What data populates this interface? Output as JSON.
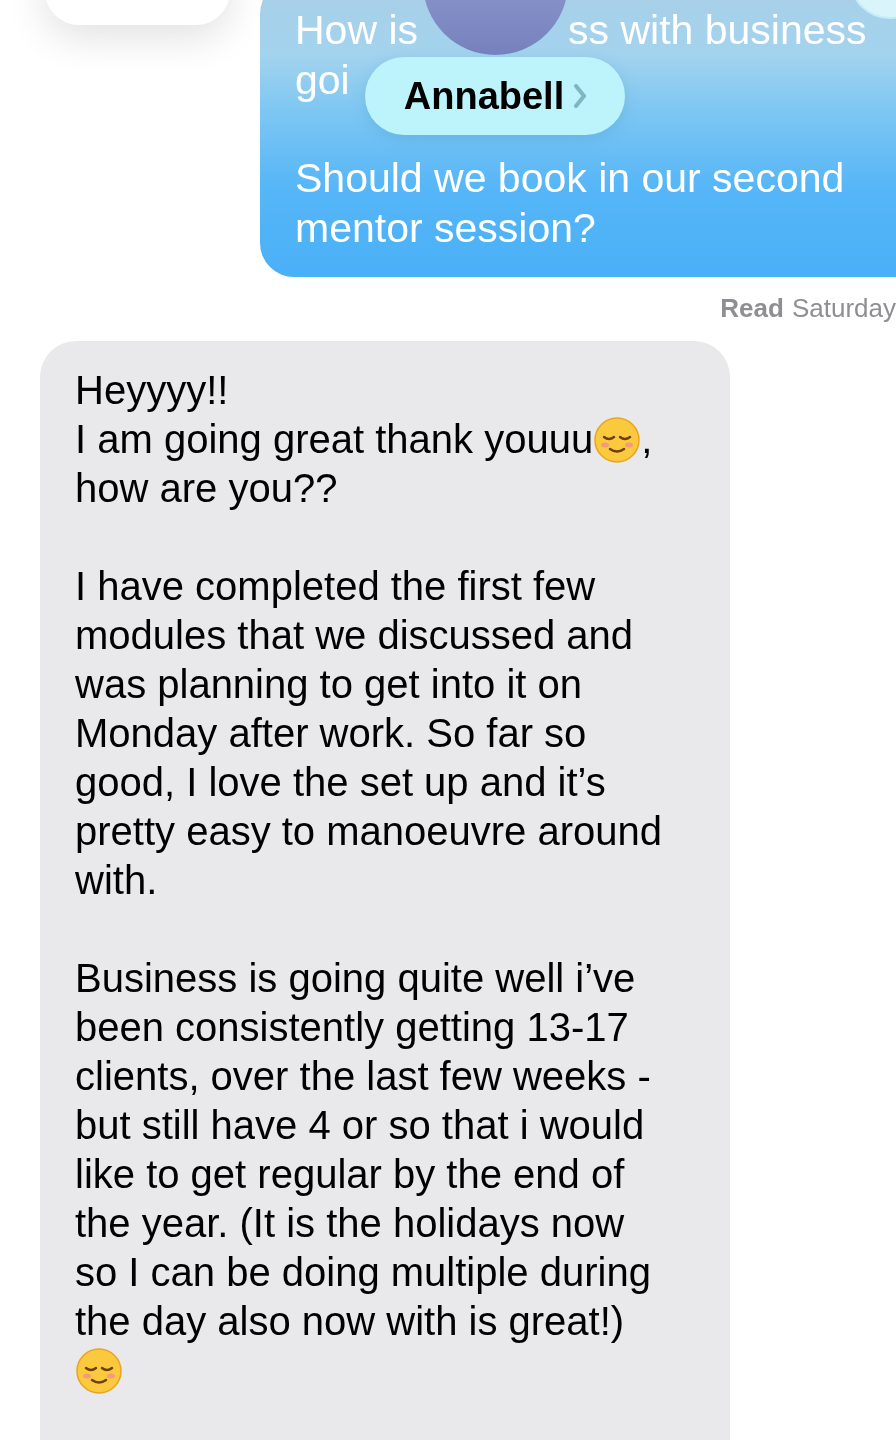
{
  "sent_message_hidden": {
    "lines": [
      {
        "fragments": [
          "How is",
          "ss with business"
        ]
      },
      {
        "fragments": [
          "goi"
        ]
      }
    ]
  },
  "contact_pill": {
    "name": "Annabell"
  },
  "sent_message": {
    "text": "Should we book in our second\nmentor session?"
  },
  "read_receipt": {
    "label": "Read",
    "time": "Saturday"
  },
  "received_message": {
    "paragraphs": [
      {
        "lines": [
          [
            {
              "kind": "text",
              "text": "Heyyyy!!"
            }
          ],
          [
            {
              "kind": "text",
              "text": "I am going great thank youuu"
            },
            {
              "kind": "emoji"
            },
            {
              "kind": "text",
              "text": ","
            }
          ],
          [
            {
              "kind": "text",
              "text": "how are you??"
            }
          ]
        ]
      },
      {
        "lines": [
          [
            {
              "kind": "text",
              "text": "I have completed the first few"
            }
          ],
          [
            {
              "kind": "text",
              "text": "modules that we discussed and"
            }
          ],
          [
            {
              "kind": "text",
              "text": "was planning to get into it on"
            }
          ],
          [
            {
              "kind": "text",
              "text": "Monday after work. So far so"
            }
          ],
          [
            {
              "kind": "text",
              "text": "good, I love the set up and it’s"
            }
          ],
          [
            {
              "kind": "text",
              "text": "pretty easy to manoeuvre around"
            }
          ],
          [
            {
              "kind": "text",
              "text": "with."
            }
          ]
        ]
      },
      {
        "lines": [
          [
            {
              "kind": "text",
              "text": "Business is going quite well i’ve"
            }
          ],
          [
            {
              "kind": "text",
              "text": "been consistently getting 13-17"
            }
          ],
          [
            {
              "kind": "text",
              "text": "clients, over the last few weeks -"
            }
          ],
          [
            {
              "kind": "text",
              "text": "but still have 4 or so that i would"
            }
          ],
          [
            {
              "kind": "text",
              "text": "like to get regular by the end of"
            }
          ],
          [
            {
              "kind": "text",
              "text": "the year. (It is the holidays now"
            }
          ],
          [
            {
              "kind": "text",
              "text": "so I can be doing multiple during"
            }
          ],
          [
            {
              "kind": "text",
              "text": "the day also now with is great!)"
            }
          ],
          [
            {
              "kind": "emoji"
            }
          ]
        ]
      }
    ]
  }
}
